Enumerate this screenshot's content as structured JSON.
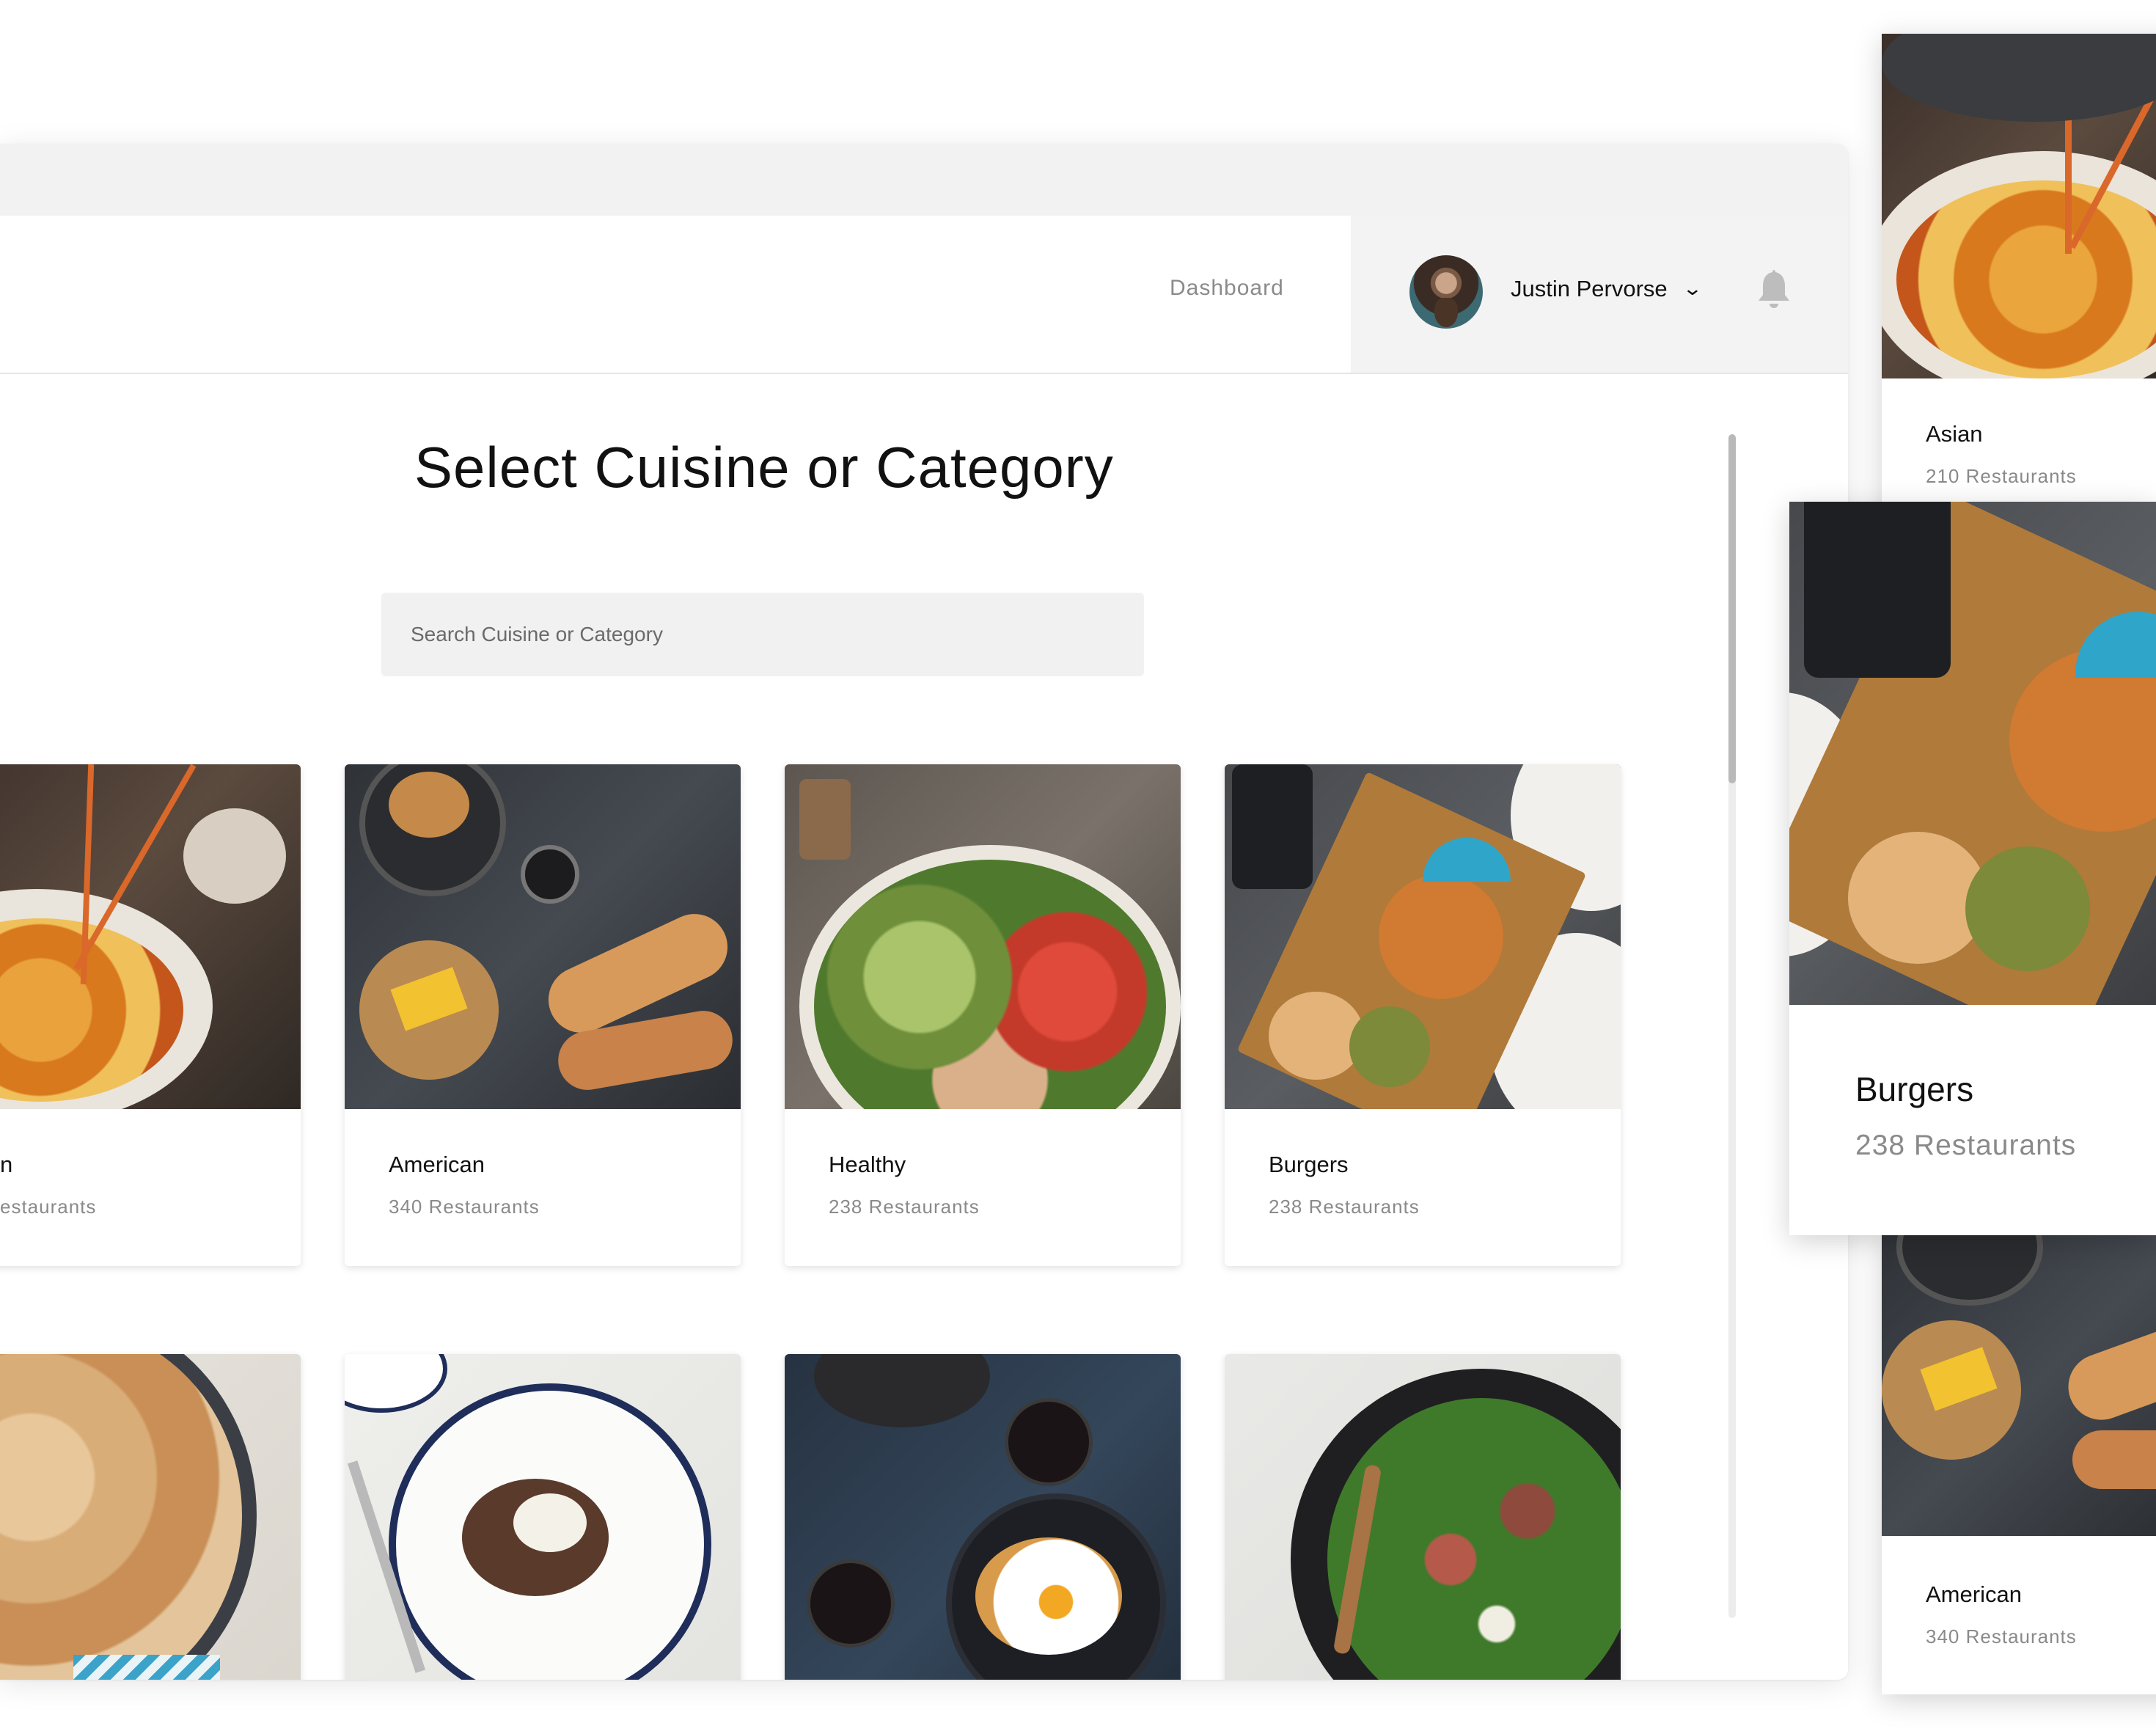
{
  "nav": {
    "dashboard_label": "Dashboard",
    "user_name": "Justin Pervorse"
  },
  "main": {
    "title": "Select Cuisine or Category",
    "search_placeholder": "Search Cuisine or Category"
  },
  "cards": [
    {
      "name": "n",
      "count": "estaurants"
    },
    {
      "name": "American",
      "count": "340 Restaurants"
    },
    {
      "name": "Healthy",
      "count": "238 Restaurants"
    },
    {
      "name": "Burgers",
      "count": "238 Restaurants"
    }
  ],
  "floating_cards": [
    {
      "name": "Asian",
      "count": "210 Restaurants"
    },
    {
      "name": "Burgers",
      "count": "238 Restaurants"
    },
    {
      "name": "American",
      "count": "340 Restaurants"
    }
  ],
  "icons": {
    "notifications": "bell-icon",
    "user_menu": "chevron-down-icon"
  },
  "colors": {
    "nav_panel": "#f3f3f3",
    "search_bg": "#f1f1f1",
    "muted_text": "#8a8a8a"
  }
}
